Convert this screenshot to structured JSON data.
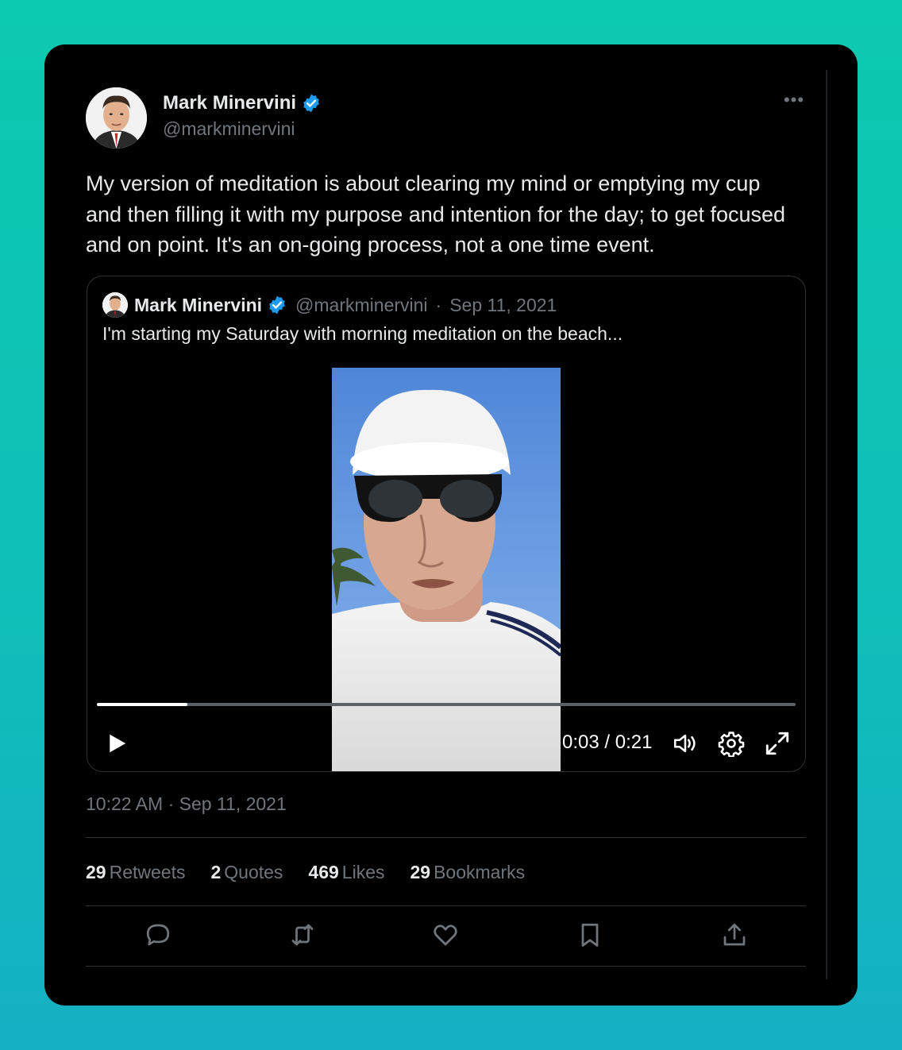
{
  "author": {
    "name": "Mark Minervini",
    "handle": "@markminervini",
    "verified": true,
    "verified_color": "#1d9bf0"
  },
  "tweet": {
    "text": "My version of meditation is about clearing my mind or emptying my cup and then filling it with my purpose and intention for the day; to get focused and on point. It's an on-going process, not a one time event.",
    "timestamp": "10:22 AM · Sep 11, 2021"
  },
  "more_icon": "more-horizontal-icon",
  "more_glyph": "•••",
  "quote": {
    "name": "Mark Minervini",
    "handle": "@markminervini",
    "date_sep": "·",
    "date": "Sep 11, 2021",
    "text": "I'm starting my Saturday with morning meditation on the beach..."
  },
  "video": {
    "time": "0:03 / 0:21",
    "progress": 0.13,
    "controls": [
      "play-icon",
      "volume-icon",
      "settings-icon",
      "fullscreen-icon"
    ]
  },
  "stats": [
    {
      "num": "29",
      "label": "Retweets"
    },
    {
      "num": "2",
      "label": "Quotes"
    },
    {
      "num": "469",
      "label": "Likes"
    },
    {
      "num": "29",
      "label": "Bookmarks"
    }
  ],
  "actions": [
    "reply-icon",
    "retweet-icon",
    "like-icon",
    "bookmark-icon",
    "share-icon"
  ],
  "colors": {
    "background": "#0ccab0",
    "card": "#000000",
    "text": "#e7e9ea",
    "muted": "#71767b",
    "border": "#2f3336"
  }
}
